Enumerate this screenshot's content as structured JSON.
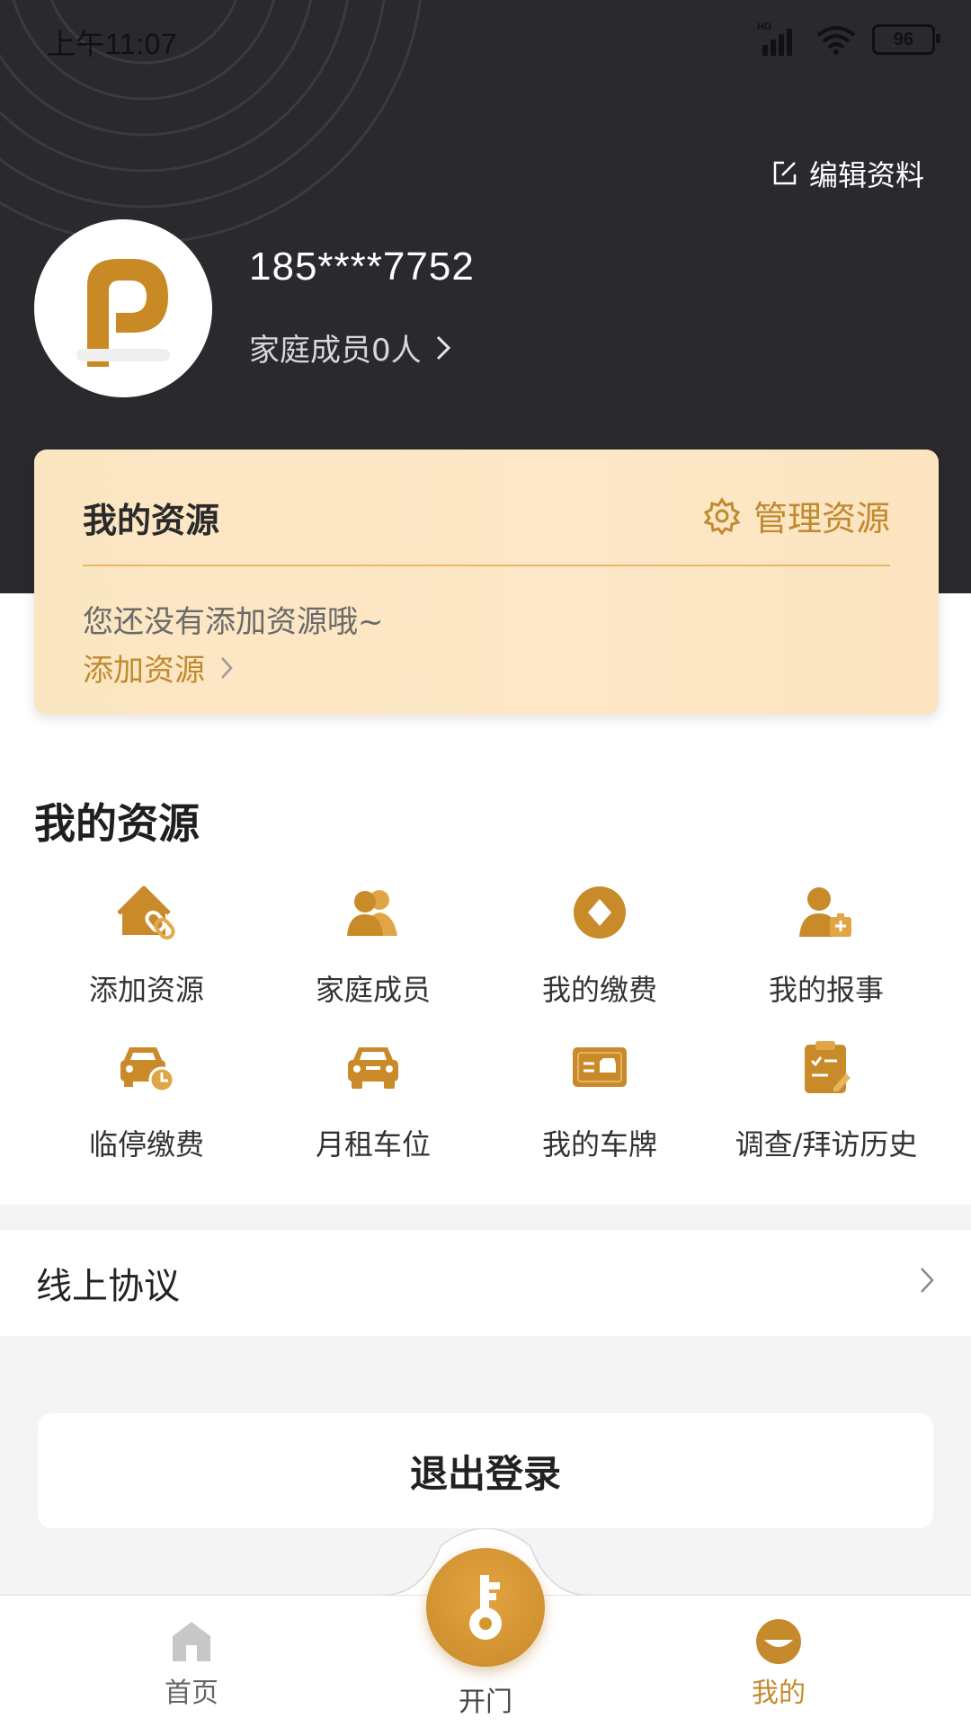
{
  "status_bar": {
    "time": "上午11:07",
    "signal_tag": "HD",
    "battery": "96"
  },
  "profile": {
    "edit_label": "编辑资料",
    "phone": "185****7752",
    "family_link": "家庭成员0人"
  },
  "resource_card": {
    "title": "我的资源",
    "manage_label": "管理资源",
    "empty_text": "您还没有添加资源哦~",
    "add_label": "添加资源"
  },
  "resources_section": {
    "title": "我的资源",
    "items": [
      {
        "label": "添加资源",
        "icon": "house-link-icon"
      },
      {
        "label": "家庭成员",
        "icon": "family-members-icon"
      },
      {
        "label": "我的缴费",
        "icon": "payment-coin-icon"
      },
      {
        "label": "我的报事",
        "icon": "report-person-icon"
      },
      {
        "label": "临停缴费",
        "icon": "car-clock-icon"
      },
      {
        "label": "月租车位",
        "icon": "car-icon"
      },
      {
        "label": "我的车牌",
        "icon": "license-plate-icon"
      },
      {
        "label": "调查/拜访历史",
        "icon": "survey-clipboard-icon"
      }
    ]
  },
  "agreement_row": {
    "label": "线上协议"
  },
  "logout": {
    "label": "退出登录"
  },
  "bottom_nav": {
    "home": "首页",
    "open_door": "开门",
    "mine": "我的",
    "active": "mine"
  },
  "colors": {
    "accent": "#c48a2c",
    "header_bg": "#2a292e",
    "card_bg": "#fce6c3"
  }
}
